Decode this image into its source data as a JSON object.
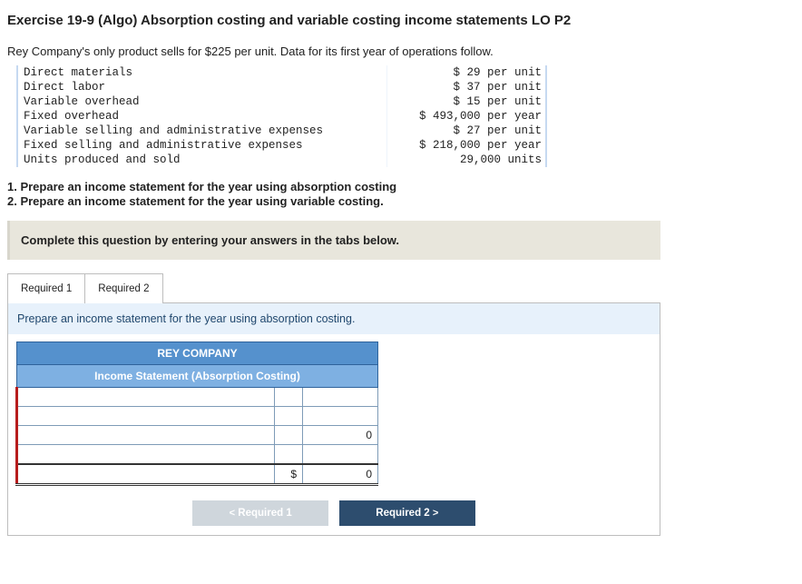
{
  "title": "Exercise 19-9 (Algo) Absorption costing and variable costing income statements LO P2",
  "intro": "Rey Company's only product sells for $225 per unit. Data for its first year of operations follow.",
  "rows": [
    {
      "label": "Direct materials",
      "value": "$ 29 per unit"
    },
    {
      "label": "Direct labor",
      "value": "$ 37 per unit"
    },
    {
      "label": "Variable overhead",
      "value": "$ 15 per unit"
    },
    {
      "label": "Fixed overhead",
      "value": "$ 493,000 per year"
    },
    {
      "label": "Variable selling and administrative expenses",
      "value": "$ 27 per unit"
    },
    {
      "label": "Fixed selling and administrative expenses",
      "value": "$ 218,000 per year"
    },
    {
      "label": "Units produced and sold",
      "value": "29,000 units"
    }
  ],
  "questions": {
    "q1": "1. Prepare an income statement for the year using absorption costing",
    "q2": "2. Prepare an income statement for the year using variable costing."
  },
  "instruction": "Complete this question by entering your answers in the tabs below.",
  "tabs": {
    "t1": "Required 1",
    "t2": "Required 2"
  },
  "panel": {
    "instruction": "Prepare an income statement for the year using absorption costing.",
    "header1": "REY COMPANY",
    "header2": "Income Statement (Absorption Costing)",
    "subtotal_value": "0",
    "total_currency": "$",
    "total_value": "0"
  },
  "nav": {
    "prev": "Required 1",
    "next": "Required 2"
  },
  "glyph": {
    "left": "<",
    "right": ">"
  }
}
